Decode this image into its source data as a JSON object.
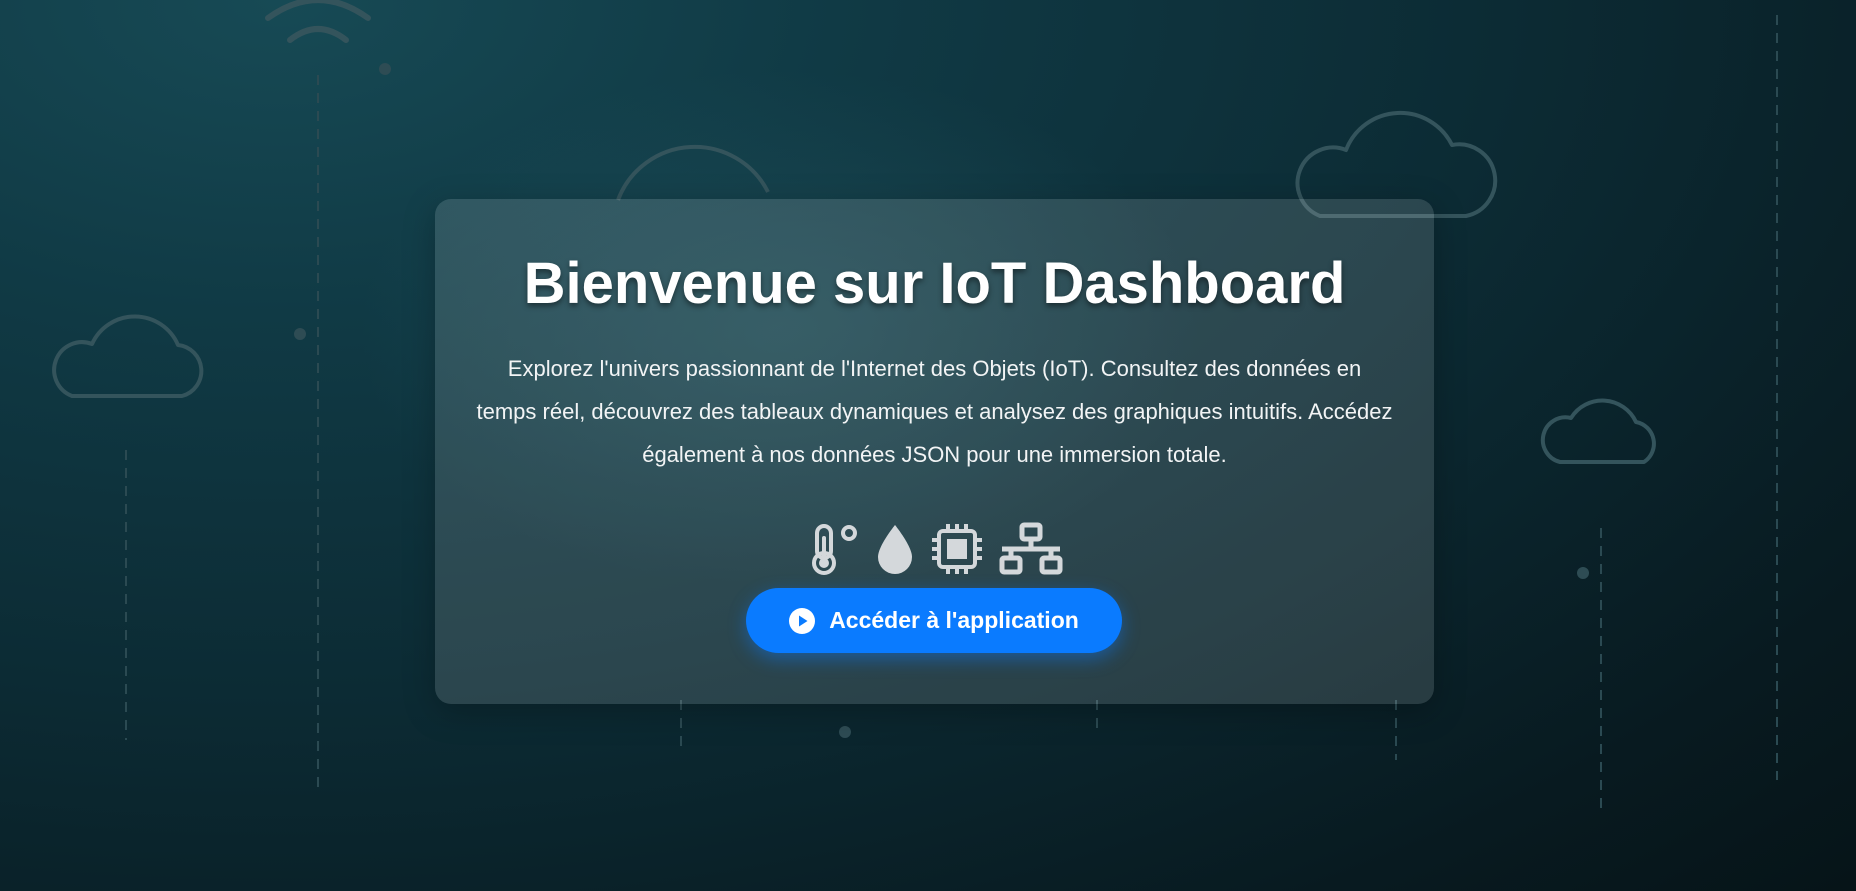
{
  "hero": {
    "title": "Bienvenue sur IoT Dashboard",
    "description": "Explorez l'univers passionnant de l'Internet des Objets (IoT). Consultez des données en temps réel, découvrez des tableaux dynamiques et analysez des graphiques intuitifs. Accédez également à nos données JSON pour une immersion totale.",
    "feature_icons": [
      "temperature-icon",
      "water-drop-icon",
      "microchip-icon",
      "network-icon"
    ],
    "cta": {
      "label": "Accéder à l'application",
      "icon": "play-circle-icon"
    }
  },
  "background": {
    "decorations": [
      "wifi-icon",
      "cloud-icon",
      "cloud-icon",
      "cloud-icon",
      "cloud-icon"
    ]
  },
  "colors": {
    "accent": "#0a7bff",
    "icon": "#d4d8db",
    "background": "#0c2b34"
  }
}
